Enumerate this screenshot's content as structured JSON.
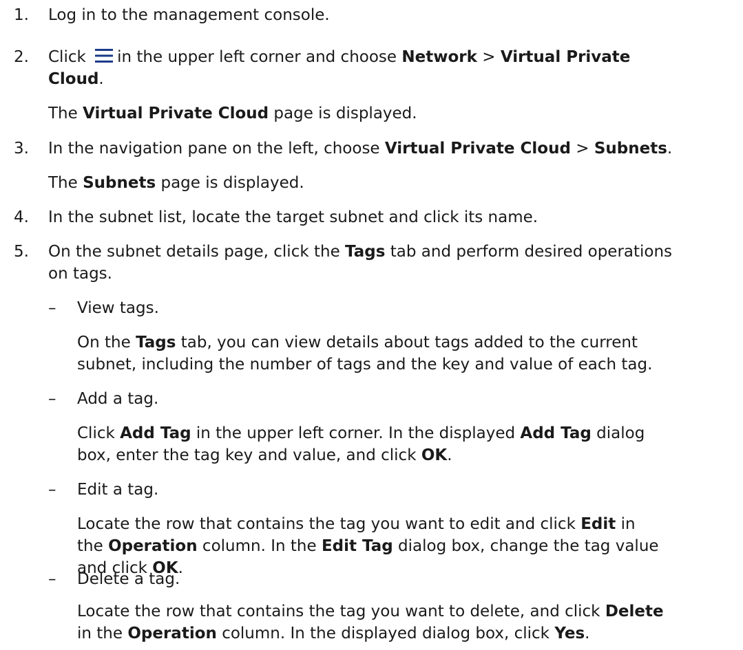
{
  "steps": [
    {
      "num": "1.",
      "parts": [
        "Log in to the management console."
      ]
    },
    {
      "num": "2.",
      "l1": [
        "Click ",
        "in the upper left corner and choose ",
        "Network",
        " > ",
        "Virtual Private"
      ],
      "l2": [
        "Cloud",
        "."
      ],
      "note": [
        "The ",
        "Virtual Private Cloud",
        " page is displayed."
      ]
    },
    {
      "num": "3.",
      "l1": [
        "In the navigation pane on the left, choose ",
        "Virtual Private Cloud",
        " > ",
        "Subnets",
        "."
      ],
      "note": [
        "The ",
        "Subnets",
        " page is displayed."
      ]
    },
    {
      "num": "4.",
      "l1": [
        "In the subnet list, locate the target subnet and click its name."
      ]
    },
    {
      "num": "5.",
      "l1": [
        "On the subnet details page, click the ",
        "Tags",
        " tab and perform desired operations"
      ],
      "l2": [
        "on tags."
      ]
    }
  ],
  "substeps": [
    {
      "dash": "–",
      "title": "View tags.",
      "b1": [
        "On the ",
        "Tags",
        " tab, you can view details about tags added to the current"
      ],
      "b2": [
        "subnet, including the number of tags and the key and value of each tag."
      ]
    },
    {
      "dash": "–",
      "title": "Add a tag.",
      "b1": [
        "Click ",
        "Add Tag",
        " in the upper left corner. In the displayed ",
        "Add Tag",
        " dialog"
      ],
      "b2": [
        "box, enter the tag key and value, and click ",
        "OK",
        "."
      ]
    },
    {
      "dash": "–",
      "title": "Edit a tag.",
      "b1": [
        "Locate the row that contains the tag you want to edit and click ",
        "Edit",
        " in"
      ],
      "b2": [
        "the ",
        "Operation",
        " column. In the ",
        "Edit Tag",
        " dialog box, change the tag value"
      ],
      "b3": [
        "and click ",
        "OK",
        "."
      ]
    },
    {
      "dash": "–",
      "title": "Delete a tag.",
      "b1": [
        "Locate the row that contains the tag you want to delete, and click ",
        "Delete"
      ],
      "b2": [
        "in the ",
        "Operation",
        " column. In the displayed dialog box, click ",
        "Yes",
        "."
      ]
    }
  ]
}
